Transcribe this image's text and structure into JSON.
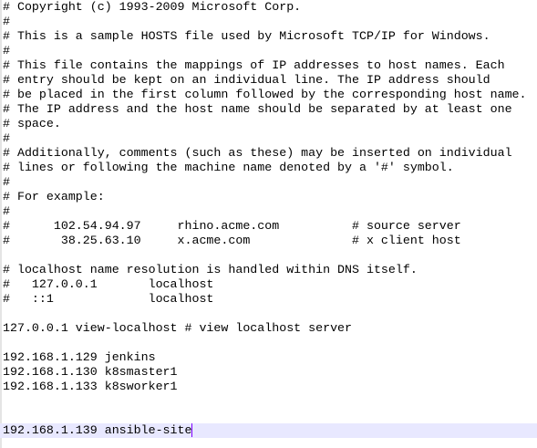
{
  "editor": {
    "lines": [
      "# Copyright (c) 1993-2009 Microsoft Corp.",
      "#",
      "# This is a sample HOSTS file used by Microsoft TCP/IP for Windows.",
      "#",
      "# This file contains the mappings of IP addresses to host names. Each",
      "# entry should be kept on an individual line. The IP address should",
      "# be placed in the first column followed by the corresponding host name.",
      "# The IP address and the host name should be separated by at least one",
      "# space.",
      "#",
      "# Additionally, comments (such as these) may be inserted on individual",
      "# lines or following the machine name denoted by a '#' symbol.",
      "#",
      "# For example:",
      "#",
      "#      102.54.94.97     rhino.acme.com          # source server",
      "#       38.25.63.10     x.acme.com              # x client host",
      "",
      "# localhost name resolution is handled within DNS itself.",
      "#   127.0.0.1       localhost",
      "#   ::1             localhost",
      "",
      "127.0.0.1 view-localhost # view localhost server",
      "",
      "192.168.1.129 jenkins",
      "192.168.1.130 k8smaster1",
      "192.168.1.133 k8sworker1",
      "",
      "",
      "192.168.1.139 ansible-site"
    ],
    "current_line_color": "#e8e8ff",
    "caret_color": "#8000ff"
  }
}
